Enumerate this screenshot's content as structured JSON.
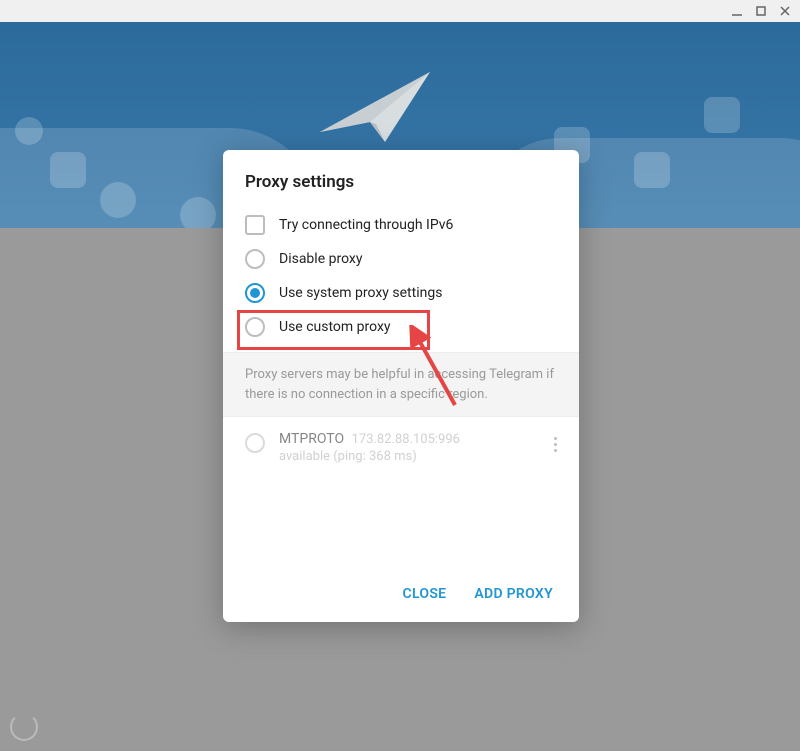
{
  "dialog": {
    "title": "Proxy settings",
    "options": {
      "ipv6": "Try connecting through IPv6",
      "disable": "Disable proxy",
      "system": "Use system proxy settings",
      "custom": "Use custom proxy"
    },
    "info": "Proxy servers may be helpful in accessing Telegram if there is no connection in a specific region.",
    "proxies": [
      {
        "protocol": "MTPROTO",
        "address": "173.82.88.105:996",
        "status": "available (ping: 368 ms)"
      }
    ],
    "buttons": {
      "close": "CLOSE",
      "add": "ADD PROXY"
    }
  },
  "colors": {
    "accent": "#2196d3",
    "highlight": "#e64545"
  }
}
